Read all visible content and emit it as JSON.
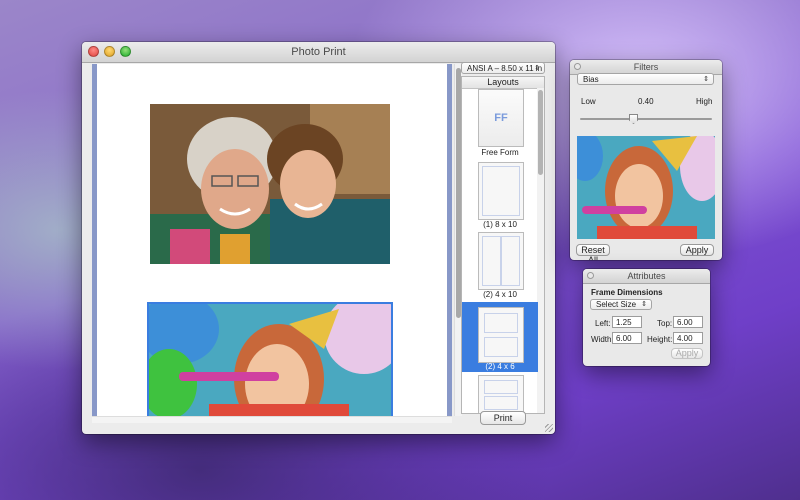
{
  "main_window": {
    "title": "Photo Print",
    "paper_size": "ANSI A – 8.50 x 11 in",
    "layouts_header": "Layouts",
    "layouts": [
      {
        "label": "Free Form",
        "thumb_text": "FF"
      },
      {
        "label": "(1) 8 x 10"
      },
      {
        "label": "(2) 4 x 10"
      },
      {
        "label": "(2) 4 x 6"
      }
    ],
    "print_label": "Print"
  },
  "filters_panel": {
    "title": "Filters",
    "filter_selected": "Bias",
    "low_label": "Low",
    "value_label": "0.40",
    "high_label": "High",
    "slider_value": 0.4,
    "reset_label": "Reset All",
    "apply_label": "Apply"
  },
  "attributes_panel": {
    "title": "Attributes",
    "section_title": "Frame Dimensions",
    "size_select": "Select Size",
    "left_label": "Left:",
    "left_value": "1.25",
    "top_label": "Top:",
    "top_value": "6.00",
    "width_label": "Width:",
    "width_value": "6.00",
    "height_label": "Height:",
    "height_value": "4.00",
    "apply_label": "Apply"
  },
  "colors": {
    "selection_blue": "#3a7de0",
    "page_border": "#8898c8"
  }
}
